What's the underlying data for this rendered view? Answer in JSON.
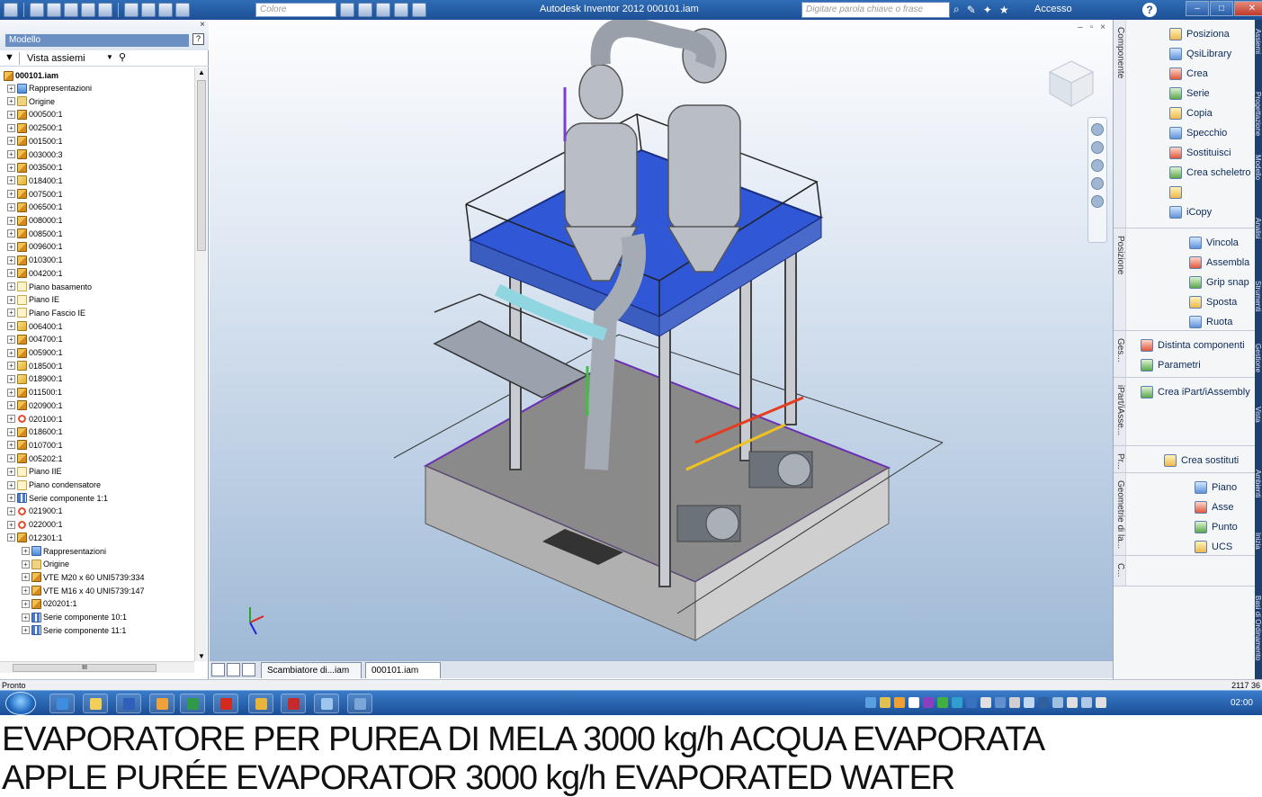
{
  "titlebar": {
    "app_title": "Autodesk Inventor 2012    000101.iam",
    "color_combo": "Colore",
    "help_search_placeholder": "Digitare parola chiave o frase",
    "access_label": "Accesso",
    "help_label": "?"
  },
  "browser": {
    "title": "Modello",
    "help": "?",
    "close": "×",
    "view_label": "Vista assiemi",
    "root": "000101.iam",
    "items": [
      {
        "label": "Rappresentazioni",
        "icon": "rep",
        "indent": 0
      },
      {
        "label": "Origine",
        "icon": "fold",
        "indent": 0
      },
      {
        "label": "000500:1",
        "icon": "asm",
        "indent": 0
      },
      {
        "label": "002500:1",
        "icon": "asm",
        "indent": 0
      },
      {
        "label": "001500:1",
        "icon": "asm",
        "indent": 0
      },
      {
        "label": "003000:3",
        "icon": "asm",
        "indent": 0
      },
      {
        "label": "003500:1",
        "icon": "asm",
        "indent": 0
      },
      {
        "label": "018400:1",
        "icon": "part",
        "indent": 0
      },
      {
        "label": "007500:1",
        "icon": "asm",
        "indent": 0
      },
      {
        "label": "006500:1",
        "icon": "asm",
        "indent": 0
      },
      {
        "label": "008000:1",
        "icon": "asm",
        "indent": 0
      },
      {
        "label": "008500:1",
        "icon": "asm",
        "indent": 0
      },
      {
        "label": "009600:1",
        "icon": "asm",
        "indent": 0
      },
      {
        "label": "010300:1",
        "icon": "asm",
        "indent": 0
      },
      {
        "label": "004200:1",
        "icon": "asm",
        "indent": 0
      },
      {
        "label": "Piano basamento",
        "icon": "plane",
        "indent": 0
      },
      {
        "label": "Piano IE",
        "icon": "plane",
        "indent": 0
      },
      {
        "label": "Piano Fascio IE",
        "icon": "plane",
        "indent": 0
      },
      {
        "label": "006400:1",
        "icon": "part",
        "indent": 0
      },
      {
        "label": "004700:1",
        "icon": "asm",
        "indent": 0
      },
      {
        "label": "005900:1",
        "icon": "asm",
        "indent": 0
      },
      {
        "label": "018500:1",
        "icon": "part",
        "indent": 0
      },
      {
        "label": "018900:1",
        "icon": "part",
        "indent": 0
      },
      {
        "label": "011500:1",
        "icon": "asm",
        "indent": 0
      },
      {
        "label": "020900:1",
        "icon": "asm",
        "indent": 0
      },
      {
        "label": "020100:1",
        "icon": "ref",
        "indent": 0
      },
      {
        "label": "018600:1",
        "icon": "asm",
        "indent": 0
      },
      {
        "label": "010700:1",
        "icon": "asm",
        "indent": 0
      },
      {
        "label": "005202:1",
        "icon": "asm",
        "indent": 0
      },
      {
        "label": "Piano IIE",
        "icon": "plane",
        "indent": 0
      },
      {
        "label": "Piano condensatore",
        "icon": "plane",
        "indent": 0
      },
      {
        "label": "Serie componente 1:1",
        "icon": "pattern",
        "indent": 0
      },
      {
        "label": "021900:1",
        "icon": "ref",
        "indent": 0
      },
      {
        "label": "022000:1",
        "icon": "ref",
        "indent": 0
      },
      {
        "label": "012301:1",
        "icon": "asm",
        "indent": 0
      },
      {
        "label": "Rappresentazioni",
        "icon": "rep",
        "indent": 1
      },
      {
        "label": "Origine",
        "icon": "fold",
        "indent": 1
      },
      {
        "label": "VTE M20 x 60 UNI5739:334",
        "icon": "asm",
        "indent": 1
      },
      {
        "label": "VTE M16 x 40 UNI5739:147",
        "icon": "asm",
        "indent": 1
      },
      {
        "label": "020201:1",
        "icon": "asm",
        "indent": 1
      },
      {
        "label": "Serie componente 10:1",
        "icon": "pattern",
        "indent": 1
      },
      {
        "label": "Serie componente 11:1",
        "icon": "pattern",
        "indent": 1
      }
    ],
    "hscroll_label": "III"
  },
  "doc_tabs": [
    "Scambiatore di...iam",
    "000101.iam"
  ],
  "ribbon": {
    "groups": [
      {
        "label": "Componente",
        "buttons": [
          "Posiziona",
          "QsiLibrary",
          "Crea",
          "Serie",
          "Copia",
          "Specchio",
          "Sostituisci",
          "Crea scheletro",
          "",
          "iCopy"
        ]
      },
      {
        "label": "Posizione",
        "buttons": [
          "Vincola",
          "Assembla",
          "Grip snap",
          "Sposta",
          "Ruota"
        ]
      },
      {
        "label": "Ges...",
        "buttons": [
          "Distinta componenti",
          "Parametri"
        ]
      },
      {
        "label": "iPart/iAsse...",
        "buttons": [
          "Crea iPart/iAssembly"
        ]
      },
      {
        "label": "Pr...",
        "buttons": [
          "Crea sostituti"
        ]
      },
      {
        "label": "Geometrie di la...",
        "buttons": [
          "Piano",
          "Asse",
          "Punto",
          "UCS"
        ]
      },
      {
        "label": "C...",
        "buttons": []
      }
    ],
    "side_tabs": [
      "Assiemi",
      "Progettazione",
      "Modello",
      "Analisi",
      "Strumenti",
      "Gestione",
      "Vista",
      "Ambienti",
      "Inizia",
      "Basi di Ordinamento"
    ]
  },
  "status": {
    "text": "Pronto",
    "count": "2117   36"
  },
  "taskbar": {
    "clock": "02:00"
  },
  "caption": {
    "line_it": "EVAPORATORE PER PUREA DI MELA 3000 kg/h ACQUA EVAPORATA",
    "line_en": "APPLE PURÉE EVAPORATOR 3000 kg/h EVAPORATED WATER"
  },
  "colors": {
    "titlebar": "#2f6db6",
    "platform": "#2f57d6",
    "concrete": "#c9c9c9",
    "outline_purple": "#6a2fb5"
  }
}
